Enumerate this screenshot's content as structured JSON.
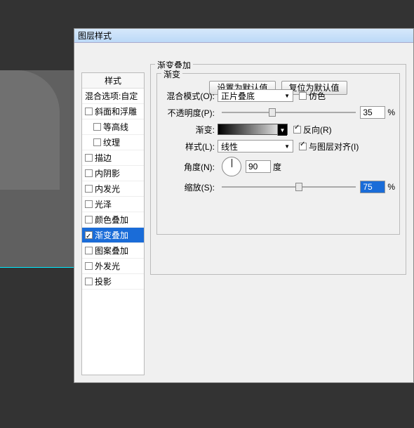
{
  "dialog": {
    "title": "图层样式"
  },
  "styles": {
    "header": "样式",
    "blend_options": "混合选项:自定",
    "items": [
      {
        "label": "斜面和浮雕",
        "checked": false,
        "indent": false
      },
      {
        "label": "等高线",
        "checked": false,
        "indent": true
      },
      {
        "label": "纹理",
        "checked": false,
        "indent": true
      },
      {
        "label": "描边",
        "checked": false,
        "indent": false
      },
      {
        "label": "内阴影",
        "checked": false,
        "indent": false
      },
      {
        "label": "内发光",
        "checked": false,
        "indent": false
      },
      {
        "label": "光泽",
        "checked": false,
        "indent": false
      },
      {
        "label": "颜色叠加",
        "checked": false,
        "indent": false
      },
      {
        "label": "渐变叠加",
        "checked": true,
        "indent": false,
        "selected": true
      },
      {
        "label": "图案叠加",
        "checked": false,
        "indent": false
      },
      {
        "label": "外发光",
        "checked": false,
        "indent": false
      },
      {
        "label": "投影",
        "checked": false,
        "indent": false
      }
    ]
  },
  "gradient_overlay": {
    "group_title": "渐变叠加",
    "inner_title": "渐变",
    "blend_mode": {
      "label": "混合模式(O):",
      "value": "正片叠底"
    },
    "dither": {
      "label": "仿色",
      "checked": false
    },
    "opacity": {
      "label": "不透明度(P):",
      "value": "35",
      "unit": "%"
    },
    "gradient": {
      "label": "渐变:"
    },
    "reverse": {
      "label": "反向(R)",
      "checked": true
    },
    "style": {
      "label": "样式(L):",
      "value": "线性"
    },
    "align": {
      "label": "与图层对齐(I)",
      "checked": true
    },
    "angle": {
      "label": "角度(N):",
      "value": "90",
      "unit": "度"
    },
    "scale": {
      "label": "缩放(S):",
      "value": "75",
      "unit": "%"
    },
    "btn_default": "设置为默认值",
    "btn_reset": "复位为默认值"
  }
}
